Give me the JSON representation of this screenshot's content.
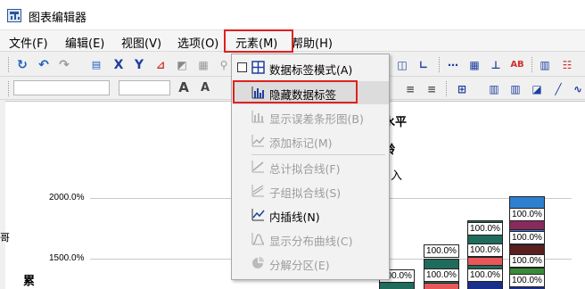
{
  "window": {
    "title": "图表编辑器"
  },
  "menubar": {
    "items": [
      {
        "id": "file",
        "label": "文件(F)"
      },
      {
        "id": "edit",
        "label": "编辑(E)"
      },
      {
        "id": "view",
        "label": "视图(V)"
      },
      {
        "id": "options",
        "label": "选项(O)"
      },
      {
        "id": "elements",
        "label": "元素(M)"
      },
      {
        "id": "help",
        "label": "帮助(H)"
      }
    ]
  },
  "toolbar2": {
    "font_grow": "A",
    "font_shrink": "A"
  },
  "elements_menu": {
    "items": [
      {
        "label": "数据标签模式(A)",
        "enabled": true,
        "checkbox": true,
        "icon": "data-label-mode-icon"
      },
      {
        "label": "隐藏数据标签",
        "enabled": true,
        "highlighted": true,
        "icon": "hide-data-labels-icon"
      },
      {
        "label": "显示误差条形图(B)",
        "enabled": false,
        "icon": "error-bars-icon"
      },
      {
        "label": "添加标记(M)",
        "enabled": false,
        "icon": "add-markers-icon"
      },
      {
        "label": "总计拟合线(F)",
        "enabled": false,
        "icon": "total-fit-line-icon"
      },
      {
        "label": "子组拟合线(S)",
        "enabled": false,
        "icon": "subgroup-fit-line-icon"
      },
      {
        "label": "内插线(N)",
        "enabled": true,
        "icon": "interpolation-line-icon"
      },
      {
        "label": "显示分布曲线(C)",
        "enabled": false,
        "icon": "distribution-curve-icon"
      },
      {
        "label": "分解分区(E)",
        "enabled": false,
        "icon": "explode-slice-icon"
      }
    ]
  },
  "chart": {
    "y_ticks": [
      "2000.0%",
      "1500.0%"
    ],
    "texts": {
      "t1": "水平",
      "t2": "龄",
      "t3": "入",
      "left": "累",
      "edge_left": "哥",
      "edge_right": "（"
    },
    "data_label": "100.0%",
    "colors": {
      "seg_blue": "#2f7fd0",
      "seg_teal": "#1f6b5c",
      "seg_red": "#e8575a",
      "seg_purple": "#8a2a5c",
      "seg_navy": "#1a2f8a",
      "seg_green": "#3a8a3a",
      "seg_maroon": "#5a1f1f"
    }
  }
}
